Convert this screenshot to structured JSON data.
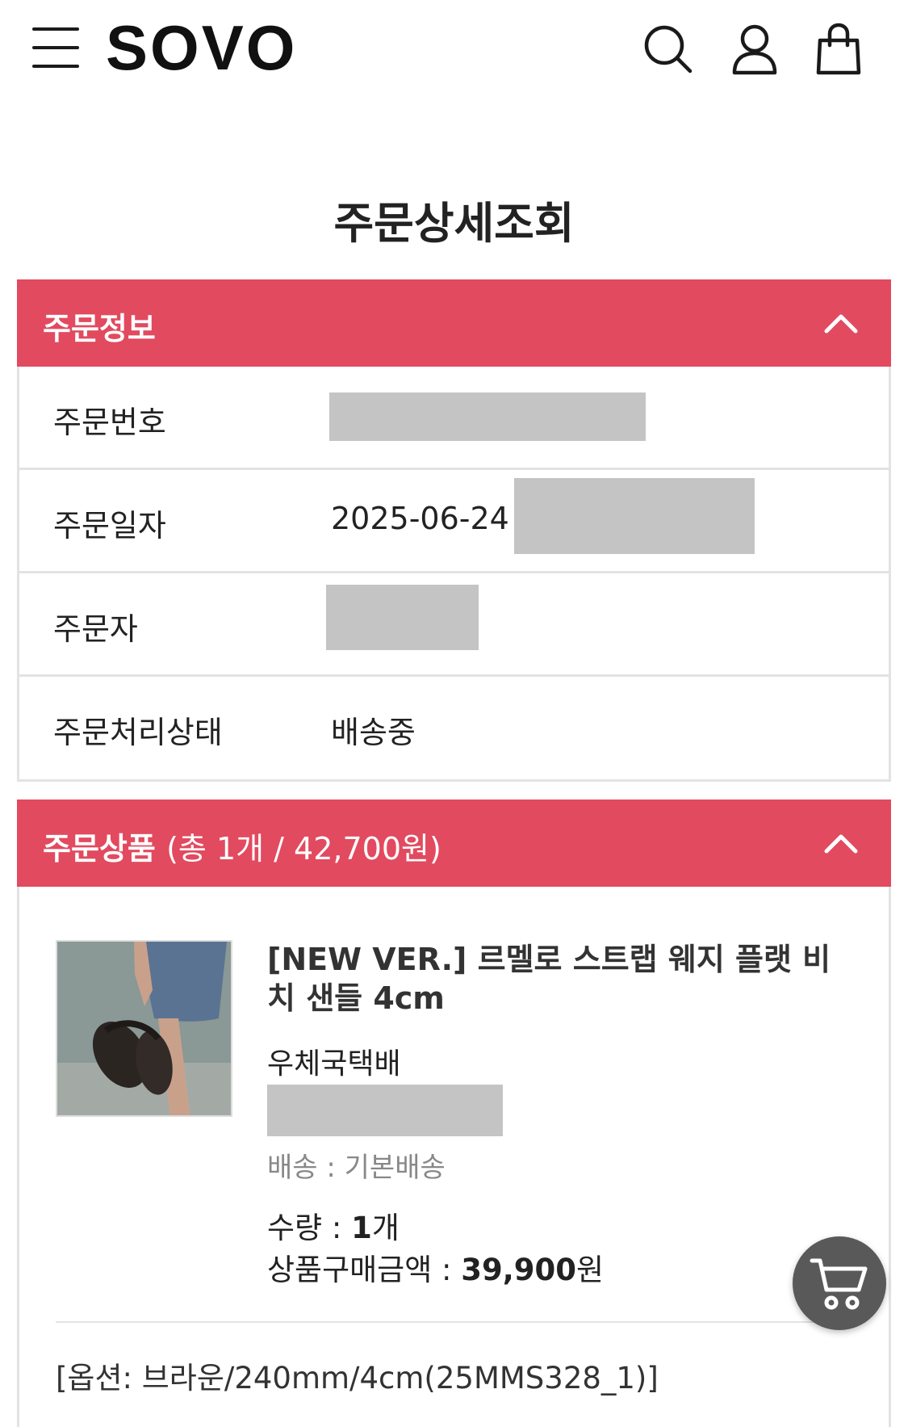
{
  "header": {
    "logo": "SOVO",
    "icons": [
      "menu-icon",
      "search-icon",
      "user-icon",
      "shopping-bag-icon"
    ]
  },
  "page": {
    "title": "주문상세조회"
  },
  "order_info": {
    "section_title": "주문정보",
    "rows": [
      {
        "label": "주문번호",
        "value": ""
      },
      {
        "label": "주문일자",
        "value": "2025-06-24 "
      },
      {
        "label": "주문자",
        "value": ""
      },
      {
        "label": "주문처리상태",
        "value": "배송중"
      }
    ]
  },
  "order_items": {
    "section_title": "주문상품",
    "summary": "(총 1개 / 42,700원)",
    "item": {
      "name": "[NEW VER.] 르멜로 스트랩 웨지 플랫 비치 샌들 4cm",
      "courier": "우체국택배",
      "shipping": "배송 : 기본배송",
      "qty_label": "수량 : ",
      "qty_value": "1",
      "qty_unit": "개",
      "price_label": "상품구매금액 : ",
      "price_value": "39,900",
      "price_unit": "원",
      "option": "[옵션: 브라운/240mm/4cm(25MMS328_1)]"
    }
  },
  "colors": {
    "accent": "#e24a5f",
    "border": "#e3e3e3",
    "mask": "#c4c4c4",
    "fab": "#595959"
  }
}
